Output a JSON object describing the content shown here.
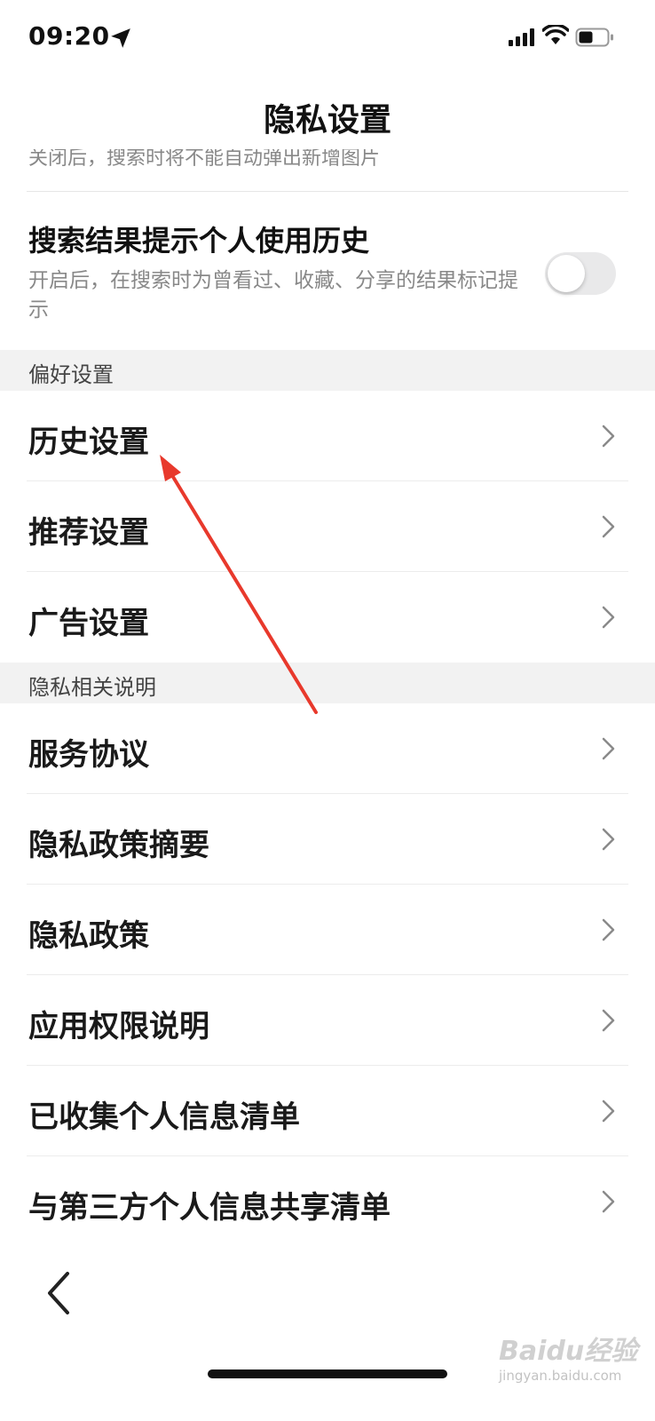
{
  "status_bar": {
    "time": "09:20",
    "icons": [
      "location-arrow-icon",
      "signal-icon",
      "wifi-icon",
      "battery-icon"
    ]
  },
  "nav": {
    "title": "隐私设置"
  },
  "clipped_description": "关闭后，搜索时将不能自动弹出新增图片",
  "toggle_setting": {
    "title": "搜索结果提示个人使用历史",
    "description": "开启后，在搜索时为曾看过、收藏、分享的结果标记提示",
    "enabled": false
  },
  "sections": [
    {
      "header": "偏好设置",
      "items": [
        {
          "label": "历史设置"
        },
        {
          "label": "推荐设置"
        },
        {
          "label": "广告设置"
        }
      ]
    },
    {
      "header": "隐私相关说明",
      "items": [
        {
          "label": "服务协议"
        },
        {
          "label": "隐私政策摘要"
        },
        {
          "label": "隐私政策"
        },
        {
          "label": "应用权限说明"
        },
        {
          "label": "已收集个人信息清单"
        },
        {
          "label": "与第三方个人信息共享清单"
        }
      ]
    }
  ],
  "watermark": {
    "brand": "Baidu经验",
    "url": "jingyan.baidu.com"
  },
  "colors": {
    "annotation_arrow": "#e8392c",
    "switch_off": "#e9e9ea",
    "section_bg": "#f2f2f2"
  }
}
